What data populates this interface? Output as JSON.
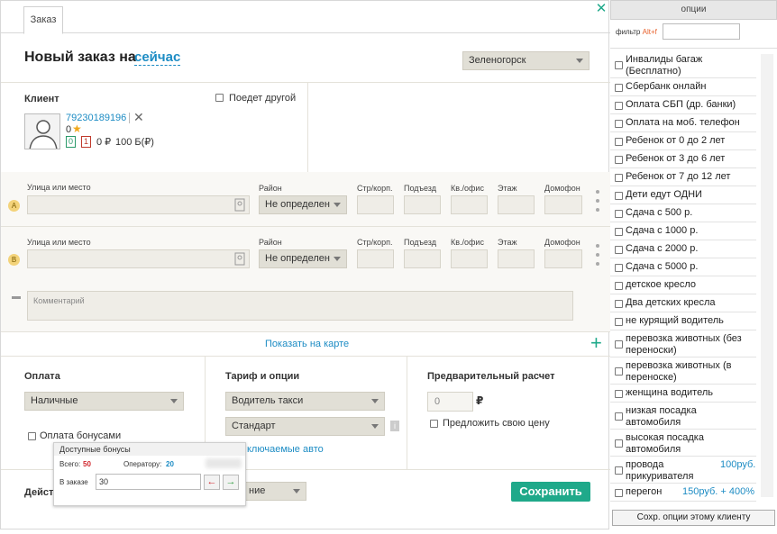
{
  "window": {
    "tab_label": "Заказ",
    "title": "Новый заказ на",
    "title_when": "сейчас",
    "city": "Зеленогорск"
  },
  "client": {
    "label": "Клиент",
    "other_rides_label": "Поедет другой",
    "phone": "79230189196",
    "rating": "0",
    "badge_green": "0",
    "badge_red": "1",
    "balance": "0 ₽",
    "bonus": "100 Б(₽)"
  },
  "addresses": [
    {
      "letter": "A",
      "street_label": "Улица или место",
      "district_label": "Район",
      "district_value": "Не определен",
      "building_label": "Стр/корп.",
      "entrance_label": "Подъезд",
      "apartment_label": "Кв./офис",
      "floor_label": "Этаж",
      "intercom_label": "Домофон"
    },
    {
      "letter": "B",
      "street_label": "Улица или место",
      "district_label": "Район",
      "district_value": "Не определен",
      "building_label": "Стр/корп.",
      "entrance_label": "Подъезд",
      "apartment_label": "Кв./офис",
      "floor_label": "Этаж",
      "intercom_label": "Домофон"
    }
  ],
  "comment_placeholder": "Комментарий",
  "show_map_label": "Показать на карте",
  "payment": {
    "label": "Оплата",
    "value": "Наличные",
    "bonus_pay_label": "Оплата бонусами"
  },
  "tariff": {
    "label": "Тариф и опции",
    "driver_value": "Водитель такси",
    "tariff_value": "Стандарт",
    "excluded_link": "ключаемые авто",
    "info_icon_text": "i"
  },
  "estimate": {
    "label": "Предварительный расчет",
    "value": "0",
    "currency": "₽",
    "offer_price_label": "Предложить свою цену"
  },
  "actions": {
    "label": "Действ",
    "dropdown_value": "ние",
    "save_label": "Сохранить"
  },
  "bonus_popup": {
    "title": "Доступные бонусы",
    "total_label": "Всего:",
    "total_value": "50",
    "operator_label": "Оператору:",
    "operator_value": "20",
    "in_order_label": "В заказе",
    "in_order_value": "30",
    "left_arrow": "←",
    "right_arrow": "→"
  },
  "options_panel": {
    "header": "опции",
    "filter_label": "фильтр",
    "filter_hotkey": "Alt+f",
    "save_button": "Сохр. опции этому клиенту",
    "items": [
      {
        "label": "Инвалиды багаж (Бесплатно)"
      },
      {
        "label": "Сбербанк онлайн"
      },
      {
        "label": "Оплата СБП (др. банки)"
      },
      {
        "label": "Оплата на моб. телефон"
      },
      {
        "label": "Ребенок от 0 до 2 лет"
      },
      {
        "label": "Ребенок от 3 до 6 лет"
      },
      {
        "label": "Ребенок от 7 до 12 лет"
      },
      {
        "label": "Дети едут ОДНИ"
      },
      {
        "label": "Сдача с 500 р."
      },
      {
        "label": "Сдача с 1000 р."
      },
      {
        "label": "Сдача с 2000 р."
      },
      {
        "label": "Сдача с 5000 р."
      },
      {
        "label": "детское кресло"
      },
      {
        "label": "Два детских кресла"
      },
      {
        "label": "не курящий водитель"
      },
      {
        "label": "перевозка животных (без переноски)"
      },
      {
        "label": "перевозка животных (в переноске)"
      },
      {
        "label": "женщина водитель"
      },
      {
        "label": "низкая посадка автомобиля"
      },
      {
        "label": "высокая посадка автомобиля"
      },
      {
        "label": "провода прикуривателя",
        "price": "100руб."
      },
      {
        "label": "перегон",
        "price": "150руб. + 400%"
      }
    ]
  }
}
